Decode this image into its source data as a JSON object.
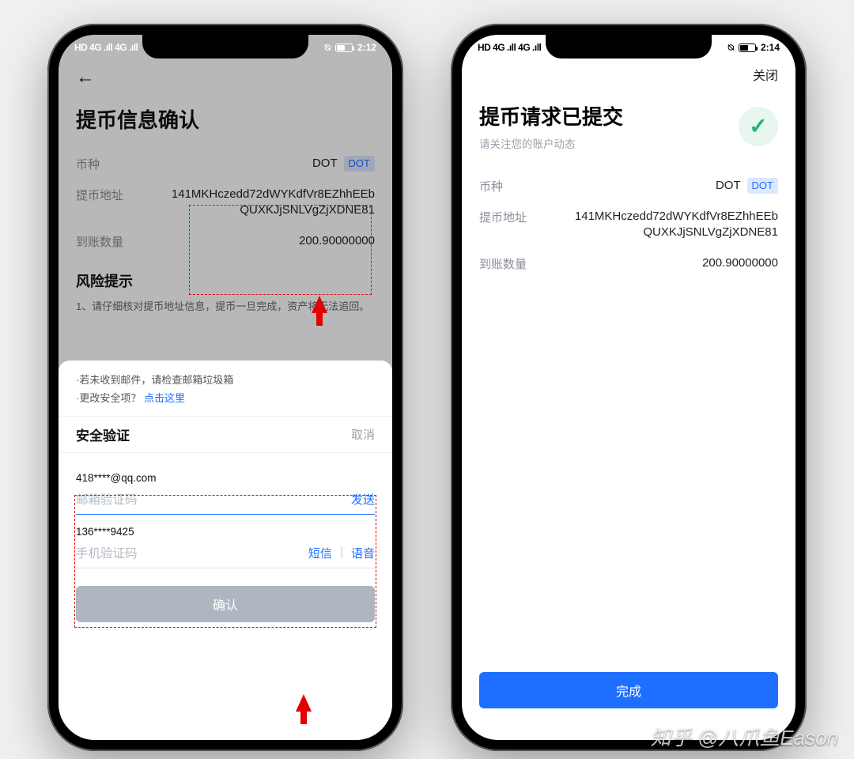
{
  "left": {
    "status": {
      "left": "HD 4G .ıll 4G .ıll",
      "time": "2:12"
    },
    "back_icon": "←",
    "title": "提币信息确认",
    "rows": {
      "coin_label": "币种",
      "coin_value": "DOT",
      "coin_badge": "DOT",
      "addr_label": "提币地址",
      "addr_value": "141MKHczedd72dWYKdfVr8EZhhEEbQUXKJjSNLVgZjXDNE81",
      "amount_label": "到账数量",
      "amount_value": "200.90000000"
    },
    "risk": {
      "title": "风险提示",
      "body": "1、请仔细核对提币地址信息，提币一旦完成，资产将无法追回。"
    },
    "sheet": {
      "hint1_prefix": "·若未收到邮件，请检查邮箱垃圾箱",
      "hint2_prefix": "·更改安全项？",
      "hint2_link": "点击这里",
      "title": "安全验证",
      "cancel": "取消",
      "email": "418****@qq.com",
      "email_code_placeholder": "邮箱验证码",
      "send": "发送",
      "phone": "136****9425",
      "phone_code_placeholder": "手机验证码",
      "sms": "短信",
      "voice": "语音",
      "confirm": "确认"
    }
  },
  "right": {
    "status": {
      "left": "HD 4G .ıll 4G .ıll",
      "time": "2:14"
    },
    "close": "关闭",
    "title": "提币请求已提交",
    "subtitle": "请关注您的账户动态",
    "rows": {
      "coin_label": "币种",
      "coin_value": "DOT",
      "coin_badge": "DOT",
      "addr_label": "提币地址",
      "addr_value": "141MKHczedd72dWYKdfVr8EZhhEEbQUXKJjSNLVgZjXDNE81",
      "amount_label": "到账数量",
      "amount_value": "200.90000000"
    },
    "done": "完成"
  },
  "watermark": "知乎 @八爪鱼Eason"
}
